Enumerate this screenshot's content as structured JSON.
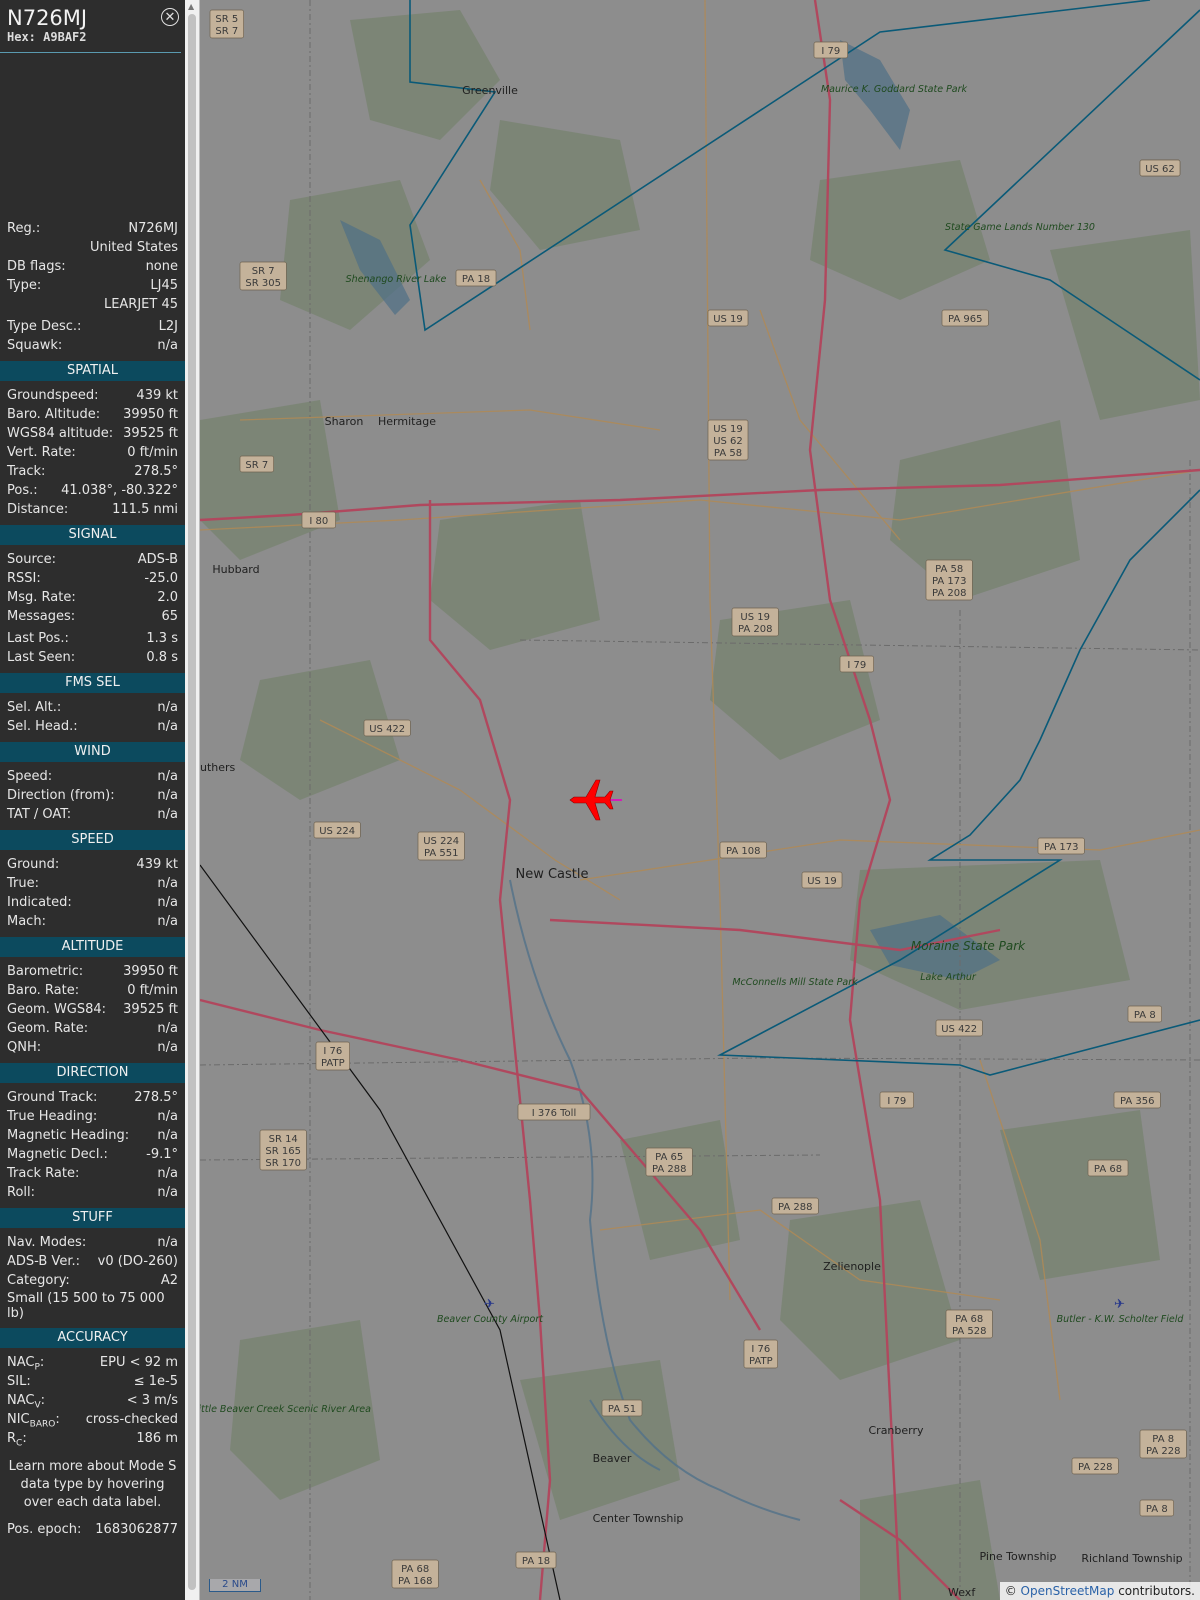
{
  "aircraft": {
    "callsign": "N726MJ",
    "hex_label": "Hex:",
    "hex": "A9BAF2"
  },
  "info": [
    {
      "label": "Reg.:",
      "value": "N726MJ"
    },
    {
      "label": "",
      "value": "United States"
    },
    {
      "label": "DB flags:",
      "value": "none"
    },
    {
      "label": "Type:",
      "value": "LJ45"
    },
    {
      "label": "",
      "value": "LEARJET 45"
    },
    {
      "label": "Type Desc.:",
      "value": "L2J"
    },
    {
      "label": "Squawk:",
      "value": "n/a"
    }
  ],
  "sections": {
    "spatial": {
      "title": "SPATIAL",
      "rows": [
        {
          "label": "Groundspeed:",
          "value": "439 kt"
        },
        {
          "label": "Baro. Altitude:",
          "value": "39950 ft"
        },
        {
          "label": "WGS84 altitude:",
          "value": "39525 ft"
        },
        {
          "label": "Vert. Rate:",
          "value": "0 ft/min"
        },
        {
          "label": "Track:",
          "value": "278.5°"
        },
        {
          "label": "Pos.:",
          "value": "41.038°, -80.322°"
        },
        {
          "label": "Distance:",
          "value": "111.5 nmi"
        }
      ]
    },
    "signal": {
      "title": "SIGNAL",
      "rows": [
        {
          "label": "Source:",
          "value": "ADS-B"
        },
        {
          "label": "RSSI:",
          "value": "-25.0"
        },
        {
          "label": "Msg. Rate:",
          "value": "2.0"
        },
        {
          "label": "Messages:",
          "value": "65"
        },
        {
          "label": "Last Pos.:",
          "value": "1.3 s"
        },
        {
          "label": "Last Seen:",
          "value": "0.8 s"
        }
      ]
    },
    "fms": {
      "title": "FMS SEL",
      "rows": [
        {
          "label": "Sel. Alt.:",
          "value": "n/a"
        },
        {
          "label": "Sel. Head.:",
          "value": "n/a"
        }
      ]
    },
    "wind": {
      "title": "WIND",
      "rows": [
        {
          "label": "Speed:",
          "value": "n/a"
        },
        {
          "label": "Direction (from):",
          "value": "n/a"
        },
        {
          "label": "TAT / OAT:",
          "value": "n/a"
        }
      ]
    },
    "speed": {
      "title": "SPEED",
      "rows": [
        {
          "label": "Ground:",
          "value": "439 kt"
        },
        {
          "label": "True:",
          "value": "n/a"
        },
        {
          "label": "Indicated:",
          "value": "n/a"
        },
        {
          "label": "Mach:",
          "value": "n/a"
        }
      ]
    },
    "altitude": {
      "title": "ALTITUDE",
      "rows": [
        {
          "label": "Barometric:",
          "value": "39950 ft"
        },
        {
          "label": "Baro. Rate:",
          "value": "0 ft/min"
        },
        {
          "label": "Geom. WGS84:",
          "value": "39525 ft"
        },
        {
          "label": "Geom. Rate:",
          "value": "n/a"
        },
        {
          "label": "QNH:",
          "value": "n/a"
        }
      ]
    },
    "direction": {
      "title": "DIRECTION",
      "rows": [
        {
          "label": "Ground Track:",
          "value": "278.5°"
        },
        {
          "label": "True Heading:",
          "value": "n/a"
        },
        {
          "label": "Magnetic Heading:",
          "value": "n/a"
        },
        {
          "label": "Magnetic Decl.:",
          "value": "-9.1°"
        },
        {
          "label": "Track Rate:",
          "value": "n/a"
        },
        {
          "label": "Roll:",
          "value": "n/a"
        }
      ]
    },
    "stuff": {
      "title": "STUFF",
      "rows": [
        {
          "label": "Nav. Modes:",
          "value": "n/a"
        },
        {
          "label": "ADS-B Ver.:",
          "value": "v0 (DO-260)"
        },
        {
          "label": "Category:",
          "value": "A2"
        }
      ],
      "category_desc": "Small (15 500 to 75 000 lb)"
    },
    "accuracy": {
      "title": "ACCURACY",
      "rows": [
        {
          "label": "NAC",
          "sub": "P",
          "value": "EPU < 92 m"
        },
        {
          "label": "SIL:",
          "sub": "",
          "value": "≤ 1e-5"
        },
        {
          "label": "NAC",
          "sub": "V",
          "value": "< 3 m/s"
        },
        {
          "label": "NIC",
          "sub": "BARO",
          "value": "cross-checked"
        },
        {
          "label": "R",
          "sub": "C",
          "value": "186 m"
        }
      ]
    }
  },
  "learn_more": "Learn more about Mode S data type by hovering over each data label.",
  "pos_epoch": {
    "label": "Pos. epoch:",
    "value": "1683062877"
  },
  "map": {
    "towns": [
      {
        "name": "Greenville",
        "size": 11
      },
      {
        "name": "Sharon",
        "size": 11
      },
      {
        "name": "Hermitage",
        "size": 11
      },
      {
        "name": "Hubbard",
        "size": 11
      },
      {
        "name": "New Castle",
        "size": 13
      },
      {
        "name": "Zelienople",
        "size": 11
      },
      {
        "name": "Cranberry",
        "size": 11
      },
      {
        "name": "Beaver",
        "size": 11
      },
      {
        "name": "Center Township",
        "size": 11
      },
      {
        "name": "Pine Township",
        "size": 11
      },
      {
        "name": "Richland Township",
        "size": 11
      },
      {
        "name": "uthers",
        "size": 11
      },
      {
        "name": "Wexf",
        "size": 11
      }
    ],
    "shields": [
      "SR 5 SR 7",
      "I 79",
      "US 62",
      "SR 7 SR 305",
      "PA 18",
      "US 19",
      "PA 965",
      "US 62",
      "US 19 US 62 PA 58",
      "SR 7",
      "I 80",
      "PA 58 PA 173 PA 208",
      "US 19 PA 208",
      "I 79",
      "US 422",
      "US 224",
      "US 224 PA 551",
      "PA 108",
      "US 19",
      "PA 173",
      "I 76 PATP",
      "US 422",
      "PA 8",
      "I 79",
      "PA 356",
      "I 376 Toll",
      "SR 14 SR 165 SR 170",
      "PA 65 PA 288",
      "PA 68",
      "PA 288",
      "PA 68 PA 528",
      "I 76 PATP",
      "PA 51",
      "PA 228",
      "PA 8 PA 228",
      "PA 8",
      "PA 68 PA 168",
      "PA 18"
    ],
    "parks": [
      "Maurice K. Goddard State Park",
      "State Game Lands Number 130",
      "Shenango River Lake",
      "McConnells Mill State Park",
      "Moraine State Park",
      "Lake Arthur",
      "Beaver County Airport",
      "Butler - K.W. Scholter Field",
      "Little Beaver Creek Scenic River Area"
    ],
    "scale_label": "2 NM",
    "attribution_prefix": "© ",
    "attribution_link": "OpenStreetMap",
    "attribution_suffix": " contributors."
  },
  "colors": {
    "section_bg": "#0c4a5e",
    "aircraft": "#ff0000",
    "range_ring": "#0a5a78"
  }
}
